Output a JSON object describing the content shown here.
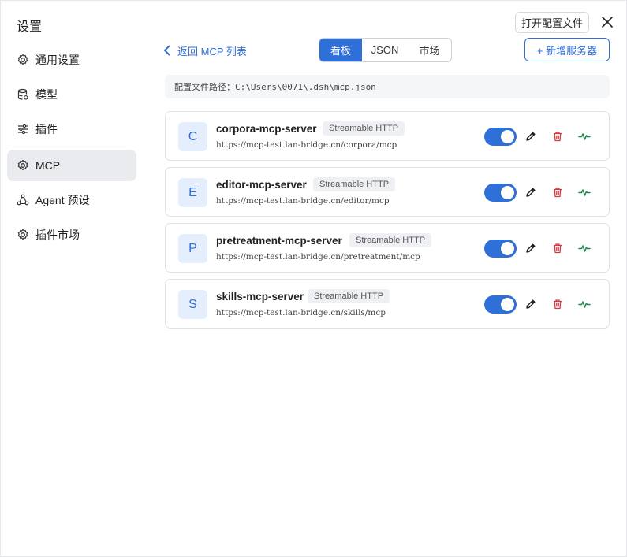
{
  "window": {
    "title": "设置",
    "open_config_label": "打开配置文件"
  },
  "sidebar": {
    "items": [
      {
        "label": "通用设置",
        "icon": "gear-icon"
      },
      {
        "label": "模型",
        "icon": "database-icon"
      },
      {
        "label": "插件",
        "icon": "sliders-icon"
      },
      {
        "label": "MCP",
        "icon": "gear-icon",
        "active": true
      },
      {
        "label": "Agent 预设",
        "icon": "share-icon"
      },
      {
        "label": "插件市场",
        "icon": "gear-icon"
      }
    ]
  },
  "main": {
    "back_label": "返回 MCP 列表",
    "tabs": [
      {
        "label": "看板",
        "active": true
      },
      {
        "label": "JSON"
      },
      {
        "label": "市场"
      }
    ],
    "add_server_label": "+ 新增服务器",
    "config_path_label": "配置文件路径：",
    "config_path_value": "C:\\Users\\0071\\.dsh\\mcp.json",
    "servers": [
      {
        "initial": "C",
        "name": "corpora-mcp-server",
        "transport": "Streamable HTTP",
        "url": "https://mcp-test.lan-bridge.cn/corpora/mcp",
        "enabled": true
      },
      {
        "initial": "E",
        "name": "editor-mcp-server",
        "transport": "Streamable HTTP",
        "url": "https://mcp-test.lan-bridge.cn/editor/mcp",
        "enabled": true
      },
      {
        "initial": "P",
        "name": "pretreatment-mcp-server",
        "transport": "Streamable HTTP",
        "url": "https://mcp-test.lan-bridge.cn/pretreatment/mcp",
        "enabled": true
      },
      {
        "initial": "S",
        "name": "skills-mcp-server",
        "transport": "Streamable HTTP",
        "url": "https://mcp-test.lan-bridge.cn/skills/mcp",
        "enabled": true
      }
    ]
  },
  "colors": {
    "accent": "#2f6fd8",
    "danger": "#d9363e",
    "health": "#1f8a4c"
  }
}
